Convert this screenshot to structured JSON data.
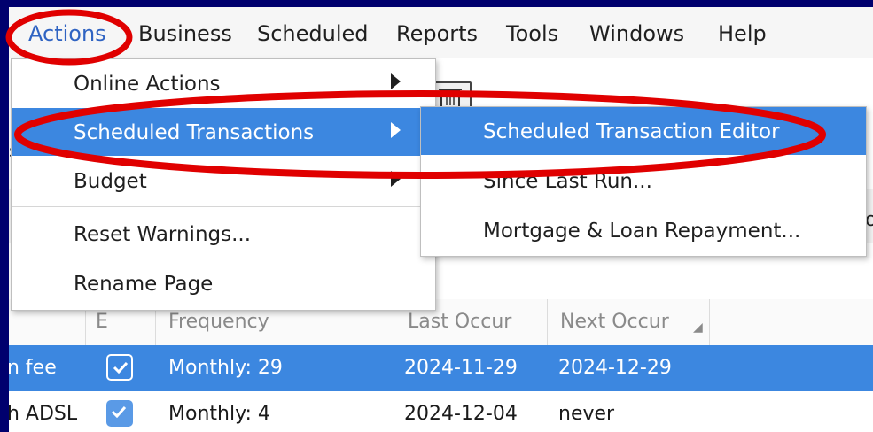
{
  "menubar": {
    "items": [
      "Actions",
      "Business",
      "Scheduled",
      "Reports",
      "Tools",
      "Windows",
      "Help"
    ]
  },
  "actions_menu": {
    "items": [
      {
        "label": "Online Actions",
        "submenu": true
      },
      {
        "label": "Scheduled Transactions",
        "submenu": true,
        "highlighted": true
      },
      {
        "label": "Budget",
        "submenu": true
      },
      {
        "label": "Reset Warnings...",
        "submenu": false
      },
      {
        "label": "Rename Page",
        "submenu": false
      }
    ]
  },
  "scheduled_submenu": {
    "items": [
      {
        "label": "Scheduled Transaction Editor",
        "highlighted": true
      },
      {
        "label": "Since Last Run..."
      },
      {
        "label": "Mortgage & Loan Repayment..."
      }
    ]
  },
  "table": {
    "columns": [
      "E",
      "Frequency",
      "Last Occur",
      "Next Occur"
    ],
    "sort_indicator": "◢",
    "rows": [
      {
        "name": "n fee",
        "enabled": true,
        "frequency": "Monthly: 29",
        "last": "2024-11-29",
        "next": "2024-12-29",
        "selected": true
      },
      {
        "name": "h ADSL",
        "enabled": true,
        "frequency": "Monthly: 4",
        "last": "2024-12-04",
        "next": "never",
        "selected": false
      }
    ]
  },
  "colors": {
    "highlight": "#3c87e0",
    "annotation": "#e00000",
    "backdrop": "#00006e"
  },
  "icons": {
    "toolbar_icon": "delete-icon",
    "submenu_arrow": "chevron-right-icon",
    "check": "checkbox-checked-icon"
  }
}
